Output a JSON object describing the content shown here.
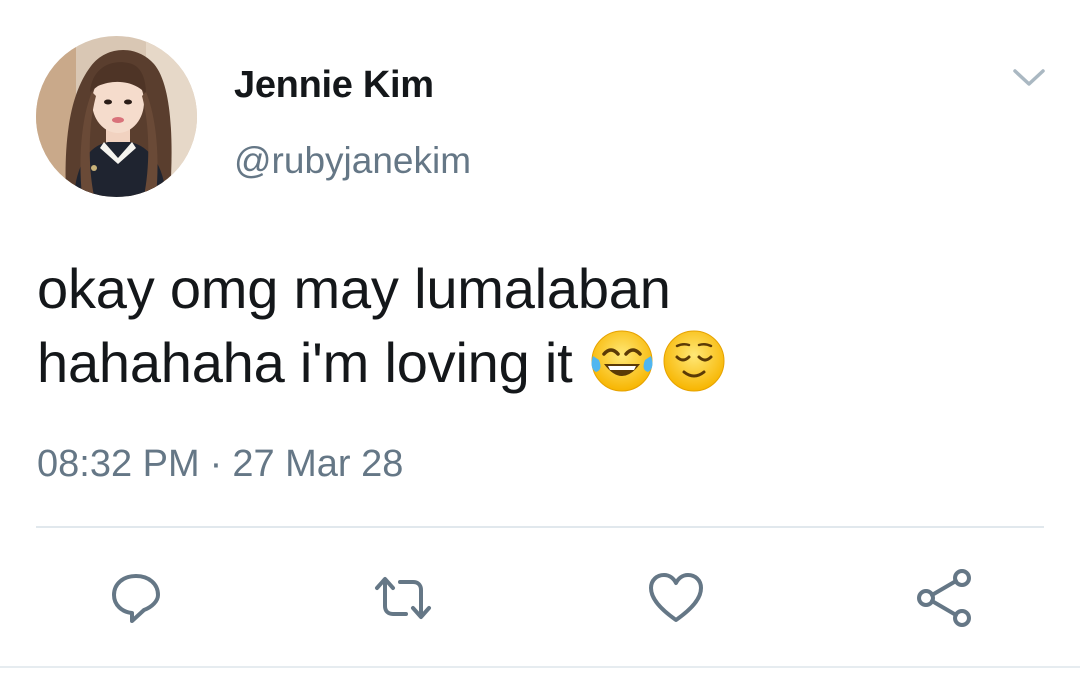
{
  "tweet": {
    "author": {
      "name": "Jennie Kim",
      "handle": "@rubyjanekim",
      "avatar_icon": "profile-photo"
    },
    "text_lines": [
      "okay omg may lumalaban",
      "hahahaha i'm loving it"
    ],
    "emojis": [
      "face-with-tears-of-joy",
      "relieved-face"
    ],
    "time": "08:32 PM",
    "separator": "·",
    "date": "27 Mar 28",
    "menu_icon": "chevron-down-icon"
  },
  "actions": [
    {
      "name": "reply",
      "icon": "reply-icon"
    },
    {
      "name": "retweet",
      "icon": "retweet-icon"
    },
    {
      "name": "like",
      "icon": "heart-icon"
    },
    {
      "name": "share",
      "icon": "share-icon"
    }
  ],
  "colors": {
    "text_primary": "#14171a",
    "text_secondary": "#657786",
    "divider": "#e1e8ed",
    "icon": "#657786"
  }
}
